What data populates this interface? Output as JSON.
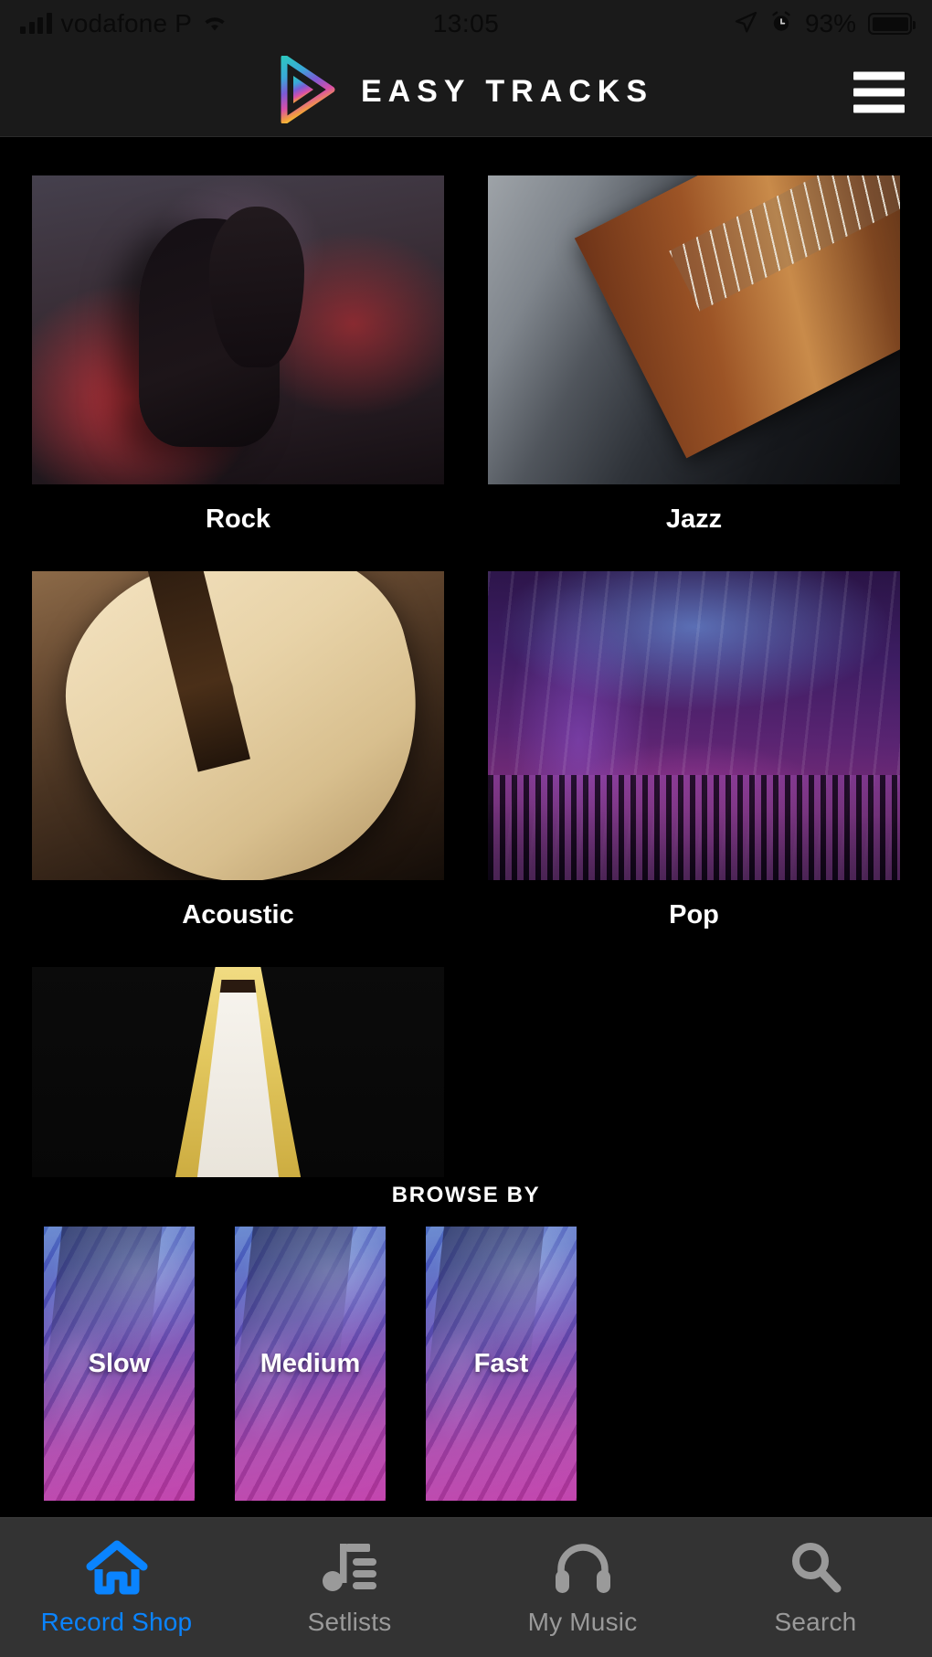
{
  "status_bar": {
    "carrier": "vodafone P",
    "time": "13:05",
    "battery_percent": "93%",
    "icons": [
      "signal-bars-icon",
      "wifi-icon",
      "location-arrow-icon",
      "alarm-clock-icon",
      "battery-icon"
    ]
  },
  "header": {
    "app_title": "EASY TRACKS",
    "logo": "play-triangle-logo",
    "menu_icon": "hamburger-menu-icon"
  },
  "genres": [
    {
      "label": "Rock",
      "art": "art-rock",
      "partial": false
    },
    {
      "label": "Jazz",
      "art": "art-jazz",
      "partial": false
    },
    {
      "label": "Acoustic",
      "art": "art-acoustic",
      "partial": false
    },
    {
      "label": "Pop",
      "art": "art-pop",
      "partial": false
    },
    {
      "label": "",
      "art": "art-metal",
      "partial": true
    }
  ],
  "browse": {
    "heading": "BROWSE BY",
    "tempos": [
      {
        "label": "Slow"
      },
      {
        "label": "Medium"
      },
      {
        "label": "Fast"
      }
    ]
  },
  "tab_bar": {
    "items": [
      {
        "label": "Record Shop",
        "icon": "home-icon",
        "active": true
      },
      {
        "label": "Setlists",
        "icon": "music-list-icon",
        "active": false
      },
      {
        "label": "My Music",
        "icon": "headphones-icon",
        "active": false
      },
      {
        "label": "Search",
        "icon": "search-icon",
        "active": false
      }
    ]
  },
  "colors": {
    "accent_blue": "#0a84ff",
    "inactive_gray": "#9a9a9a",
    "tab_bar_bg": "#333333",
    "header_bg": "#1a1a1a",
    "page_bg": "#000000"
  }
}
